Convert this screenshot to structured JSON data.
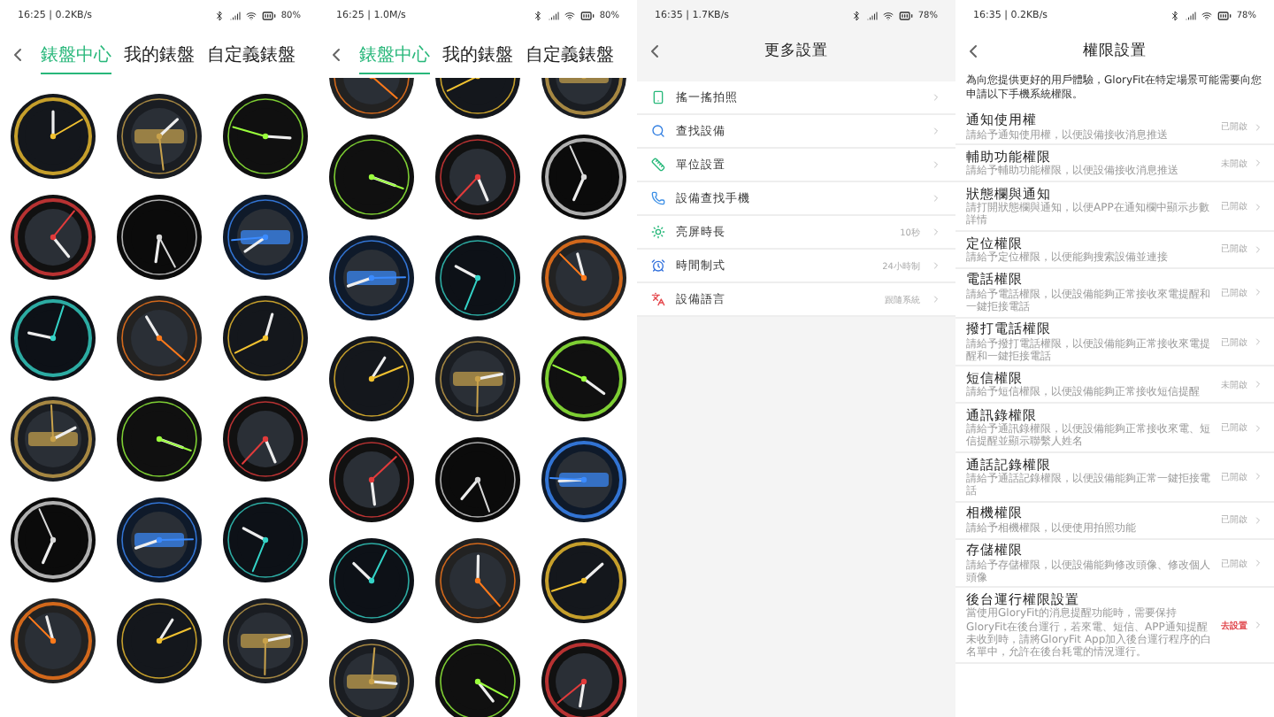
{
  "screens": [
    {
      "kind": "watch_faces",
      "status": {
        "time": "16:25 | 0.2KB/s",
        "battery": "80%"
      },
      "tabs": [
        {
          "label": "錶盤中心",
          "selected": true
        },
        {
          "label": "我的錶盤",
          "selected": false
        },
        {
          "label": "自定義錶盤",
          "selected": false
        }
      ],
      "faces": [
        {
          "kind": "picture"
        },
        {
          "kind": "picture"
        },
        {
          "kind": "picture"
        },
        {
          "kind": "picture"
        },
        {
          "kind": "picture"
        },
        {
          "kind": "picture"
        },
        {
          "kind": "picture"
        },
        {
          "kind": "picture"
        },
        {
          "kind": "picture"
        },
        {
          "kind": "picture"
        },
        {
          "kind": "picture"
        },
        {
          "kind": "picture"
        },
        {
          "kind": "picture"
        },
        {
          "kind": "picture"
        },
        {
          "kind": "picture"
        },
        {
          "kind": "picture"
        },
        {
          "kind": "picture"
        },
        {
          "kind": "picture"
        }
      ]
    },
    {
      "kind": "watch_faces",
      "status": {
        "time": "16:25 | 1.0M/s",
        "battery": "80%"
      },
      "tabs": [
        {
          "label": "錶盤中心",
          "selected": true
        },
        {
          "label": "我的錶盤",
          "selected": false
        },
        {
          "label": "自定義錶盤",
          "selected": false
        }
      ],
      "faces": [
        {
          "kind": "picture"
        },
        {
          "kind": "picture"
        },
        {
          "kind": "picture"
        },
        {
          "kind": "picture"
        },
        {
          "kind": "picture"
        },
        {
          "kind": "picture"
        },
        {
          "kind": "picture"
        },
        {
          "kind": "picture"
        },
        {
          "kind": "picture"
        },
        {
          "kind": "picture"
        },
        {
          "kind": "picture"
        },
        {
          "kind": "picture"
        },
        {
          "kind": "picture"
        },
        {
          "kind": "picture"
        },
        {
          "kind": "picture"
        },
        {
          "kind": "picture"
        },
        {
          "kind": "picture"
        },
        {
          "kind": "picture"
        },
        {
          "kind": "picture"
        },
        {
          "kind": "picture"
        },
        {
          "kind": "picture"
        }
      ]
    },
    {
      "kind": "settings_menu",
      "status": {
        "time": "16:35 | 1.7KB/s",
        "battery": "78%"
      },
      "title": "更多設置",
      "items": [
        {
          "kind": "shake",
          "label": "搖一搖拍照"
        },
        {
          "kind": "search",
          "label": "查找設備"
        },
        {
          "kind": "unit",
          "label": "單位設置"
        },
        {
          "kind": "phone",
          "label": "設備查找手機"
        },
        {
          "kind": "sun",
          "label": "亮屏時長",
          "value": "10秒"
        },
        {
          "kind": "clock",
          "label": "時間制式",
          "value": "24小時制"
        },
        {
          "kind": "language",
          "label": "設備語言",
          "value": "跟隨系統"
        }
      ]
    },
    {
      "kind": "permissions",
      "status": {
        "time": "16:35 | 0.2KB/s",
        "battery": "78%"
      },
      "title": "權限設置",
      "intro": "為向您提供更好的用戶體驗，GloryFit在特定場景可能需要向您申請以下手機系統權限。",
      "items": [
        {
          "title": "通知使用權",
          "description": "請給予通知使用權，以便設備接收消息推送",
          "status": "已開啟",
          "highlight": false
        },
        {
          "title": "輔助功能權限",
          "description": "請給予輔助功能權限，以便設備接收消息推送",
          "status": "未開啟",
          "highlight": false
        },
        {
          "title": "狀態欄與通知",
          "description": "請打開狀態欄與通知，以便APP在通知欄中顯示步數詳情",
          "status": "已開啟",
          "highlight": false
        },
        {
          "title": "定位權限",
          "description": "請給予定位權限，以便能夠搜索設備並連接",
          "status": "已開啟",
          "highlight": false
        },
        {
          "title": "電話權限",
          "description": "請給予電話權限，以便設備能夠正常接收來電提醒和一鍵拒接電話",
          "status": "已開啟",
          "highlight": false
        },
        {
          "title": "撥打電話權限",
          "description": "請給予撥打電話權限，以便設備能夠正常接收來電提醒和一鍵拒接電話",
          "status": "已開啟",
          "highlight": false
        },
        {
          "title": "短信權限",
          "description": "請給予短信權限，以便設備能夠正常接收短信提醒",
          "status": "未開啟",
          "highlight": false
        },
        {
          "title": "通訊錄權限",
          "description": "請給予通訊錄權限，以便設備能夠正常接收來電、短信提醒並顯示聯繫人姓名",
          "status": "已開啟",
          "highlight": false
        },
        {
          "title": "通話記錄權限",
          "description": "請給予通話記錄權限，以便設備能夠正常一鍵拒接電話",
          "status": "已開啟",
          "highlight": false
        },
        {
          "title": "相機權限",
          "description": "請給予相機權限，以便使用拍照功能",
          "status": "已開啟",
          "highlight": false
        },
        {
          "title": "存儲權限",
          "description": "請給予存儲權限，以便設備能夠修改頭像、修改個人頭像",
          "status": "已開啟",
          "highlight": false
        },
        {
          "title": "後台運行權限設置",
          "description": "當使用GloryFit的消息提醒功能時，需要保持GloryFit在後台運行，若來電、短信、APP通知提醒未收到時，請將GloryFit App加入後台運行程序的白名單中，允許在後台耗電的情況運行。",
          "status": "去設置",
          "highlight": true
        }
      ]
    }
  ]
}
